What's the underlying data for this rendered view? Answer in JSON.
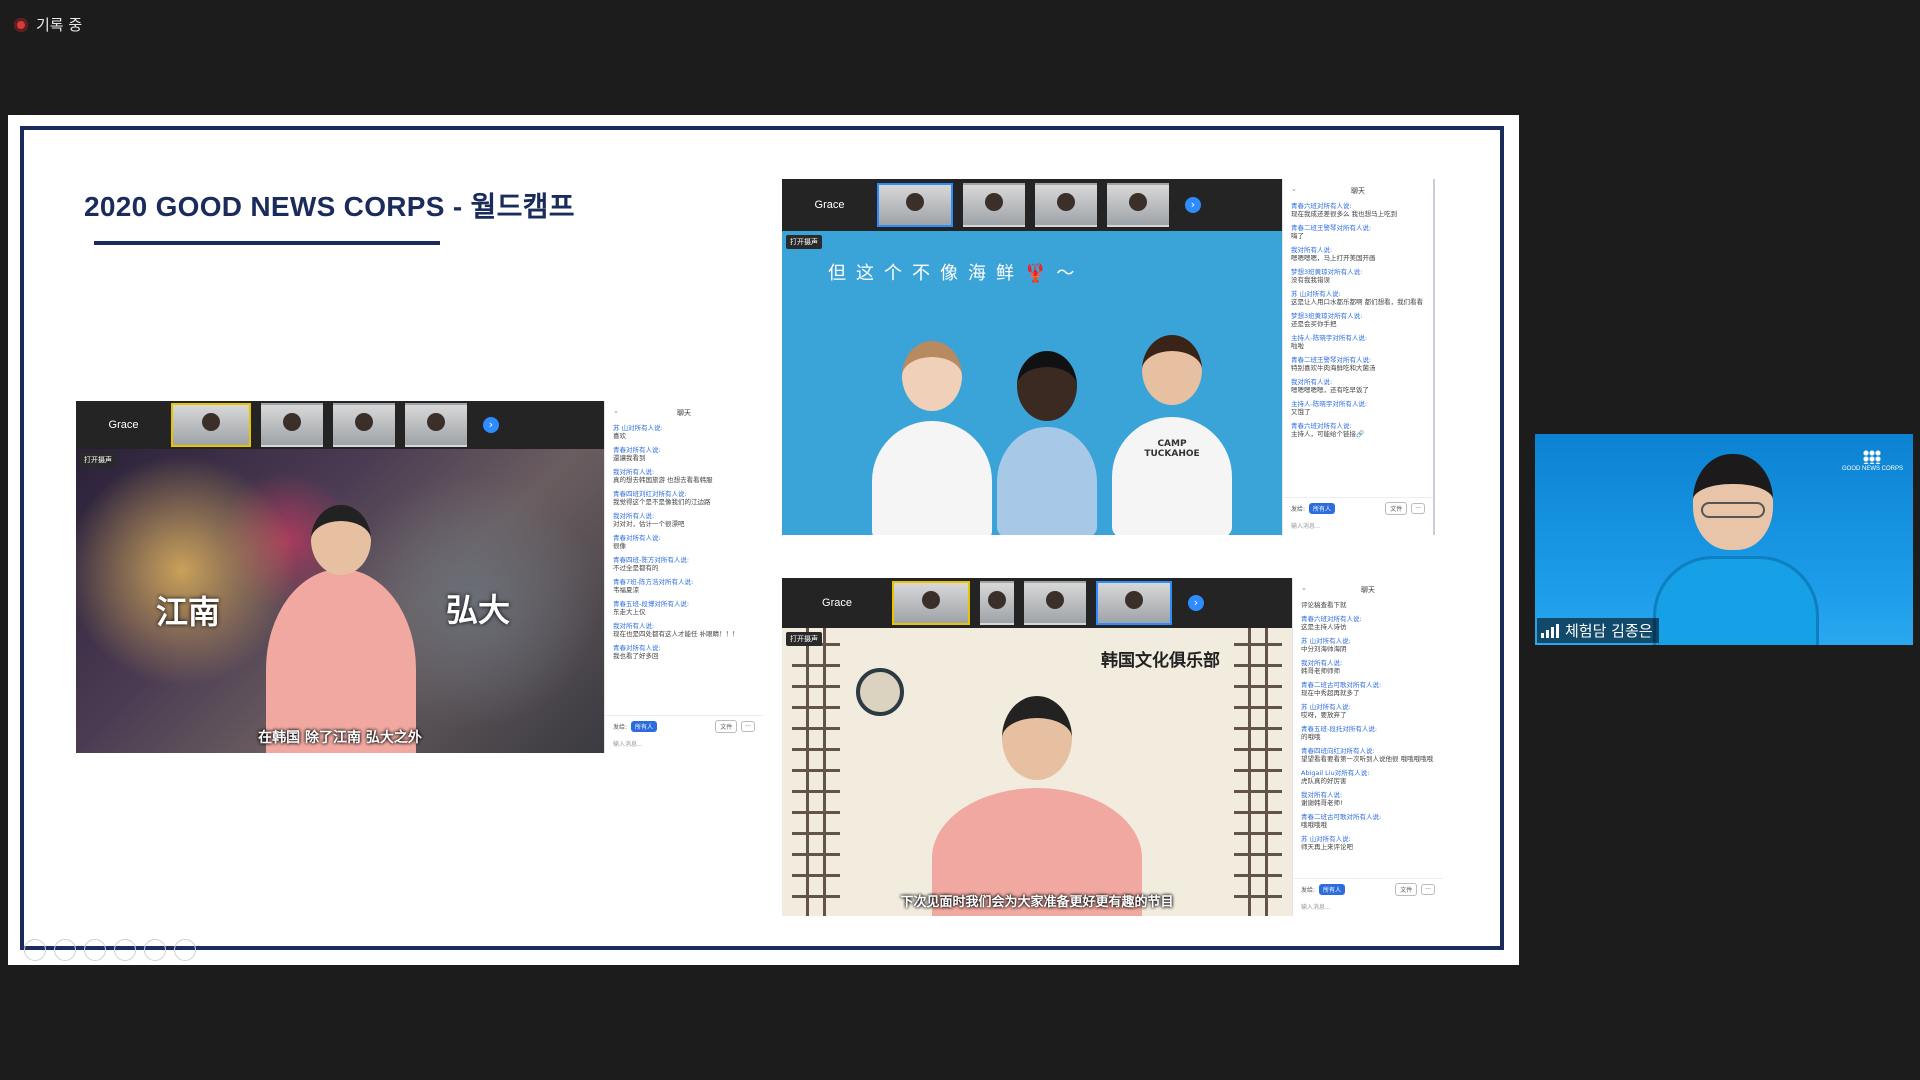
{
  "recording": {
    "label": "기록 중",
    "color": "#d93a3a"
  },
  "slide": {
    "title": "2020 GOOD NEWS CORPS - 월드캠프",
    "accent": "#1a2b5c"
  },
  "shots": {
    "left": {
      "host": "Grace",
      "unmute": "打开摄声",
      "big_left": "江南",
      "big_right": "弘大",
      "caption": "在韩国 除了江南 弘大之外",
      "chat_title": "聊天",
      "messages": [
        {
          "from": "苏 山对所有人说:",
          "text": "喜欢"
        },
        {
          "from": "青春对所有人说:",
          "text": "還讓我看到"
        },
        {
          "from": "我对所有人说:",
          "text": "真的想去韩国旅游 也想去看看韩服"
        },
        {
          "from": "青春四班刘红对所有人说:",
          "text": "我觉得这个是不是像我们的江边路"
        },
        {
          "from": "我对所有人说:",
          "text": "对对对，估计一个很漂吧"
        },
        {
          "from": "青春对所有人说:",
          "text": "很像"
        },
        {
          "from": "青春四班-陈方对所有人说:",
          "text": "不过全是都有的"
        },
        {
          "from": "青春7班-陈方浩对所有人说:",
          "text": "韦福夏涼"
        },
        {
          "from": "青春五班-段博对所有人说:",
          "text": "东走大上仅"
        },
        {
          "from": "我对所有人说:",
          "text": "现在也是四处都有这人才能任 补眼睛！！！"
        },
        {
          "from": "青春对所有人说:",
          "text": "我也看了好多回"
        }
      ],
      "send_to": "发给:",
      "to_pill": "所有人",
      "file_btn": "文件",
      "more_btn": "···",
      "input": "输入消息..."
    },
    "topright": {
      "host": "Grace",
      "unmute": "打开摄声",
      "banner": "但这个不像海鲜🦞～",
      "camp_text": "CAMP TUCKAHOE",
      "chat_title": "聊天",
      "messages": [
        {
          "from": "青春六班对所有人说:",
          "text": "现在我成还差很多么 我也想马上吃到"
        },
        {
          "from": "青春二班王警琴对所有人说:",
          "text": "嗨了"
        },
        {
          "from": "我对所有人说:",
          "text": "嗯嗯嗯嗯，马上打开美国开画"
        },
        {
          "from": "梦想3班黄琼对所有人说:",
          "text": "没有我我错误"
        },
        {
          "from": "苏 山对所有人说:",
          "text": "这是让人用口水都乐都啊 都们想看，我们看看"
        },
        {
          "from": "梦想3班黄琼对所有人说:",
          "text": "还是会买你手把"
        },
        {
          "from": "主持人-陈晓宇对所有人说:",
          "text": "啦啦"
        },
        {
          "from": "青春二班王警琴对所有人说:",
          "text": "特别喜欢牛肉海鲜吃和大菌汤"
        },
        {
          "from": "我对所有人说:",
          "text": "嗯嗯嗯嗯嗯，还有吃早饭了"
        },
        {
          "from": "主持人-陈晓宇对所有人说:",
          "text": "又饿了"
        },
        {
          "from": "青春六班对所有人说:",
          "text": "主持人，可能给个链接🔗"
        }
      ],
      "send_to": "发给:",
      "to_pill": "所有人",
      "file_btn": "文件",
      "more_btn": "···",
      "input": "输入消息..."
    },
    "bottomright": {
      "host": "Grace",
      "unmute": "打开摄声",
      "banner": "韩国文化俱乐部",
      "caption": "下次见面时我们会为大家准备更好更有趣的节目",
      "chat_title": "聊天",
      "messages": [
        {
          "from": "",
          "text": "评论稿查看下就"
        },
        {
          "from": "青春六班对所有人说:",
          "text": "这是主持人诗仿"
        },
        {
          "from": "苏 山对所有人说:",
          "text": "中分刘海帅海阴"
        },
        {
          "from": "我对所有人说:",
          "text": "韩哥老师师师"
        },
        {
          "from": "青春二班古可歌对所有人说:",
          "text": "现在中秀超再就多了"
        },
        {
          "from": "苏 山对所有人说:",
          "text": "哎呀，要放弃了"
        },
        {
          "from": "青春五班-段托对所有人说:",
          "text": "的哦哦"
        },
        {
          "from": "青春四班向红对所有人说:",
          "text": "望望看看要看第一次听到人说他很 哦哦哦哦哦"
        },
        {
          "from": "Abigail Liu对所有人说:",
          "text": "虎队真的好厉害"
        },
        {
          "from": "我对所有人说:",
          "text": "谢谢韩哥老师!"
        },
        {
          "from": "青春二班古可歌对所有人说:",
          "text": "哦哦哦哦"
        },
        {
          "from": "苏 山对所有人说:",
          "text": "师天再上来评论吧"
        }
      ],
      "send_to": "发给:",
      "to_pill": "所有人",
      "file_btn": "文件",
      "more_btn": "···",
      "input": "输入消息..."
    }
  },
  "speaker": {
    "name": "체험담 김종은",
    "brand": "GOOD NEWS CORPS"
  }
}
